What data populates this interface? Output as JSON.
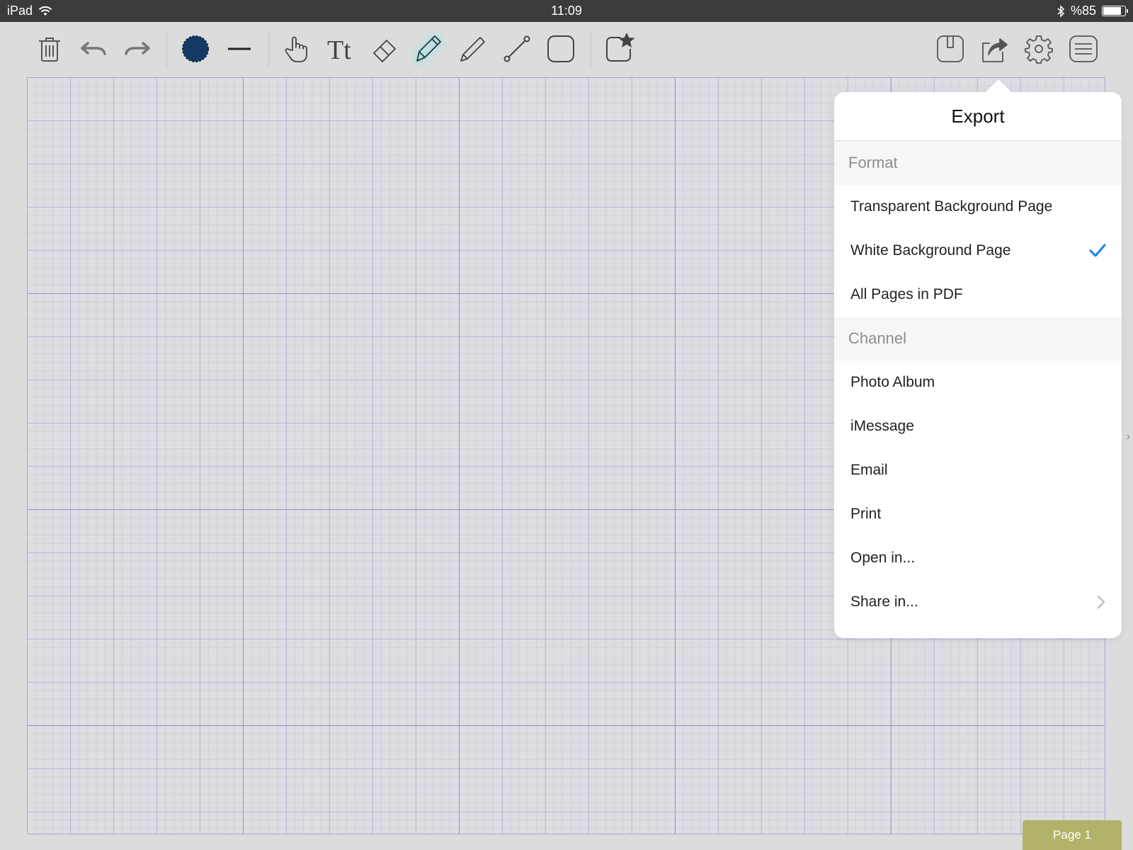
{
  "status_bar": {
    "device": "iPad",
    "time": "11:09",
    "battery": "%85",
    "battery_level": 0.85
  },
  "toolbar": {
    "tools": [
      "trash-icon",
      "undo-icon",
      "redo-icon",
      "color-swatch-icon",
      "line-width-icon",
      "hand-icon",
      "text-icon",
      "eraser-icon",
      "pen-icon",
      "pencil-icon",
      "line-tool-icon",
      "shape-icon",
      "favorites-icon",
      "page-icon",
      "share-icon",
      "gear-icon",
      "menu-icon"
    ],
    "active_tool": "pen-icon",
    "colors": {
      "icon": "#555555",
      "swatch": "#123a63",
      "glow": "#7fe0e6"
    }
  },
  "export_popover": {
    "title": "Export",
    "format_header": "Format",
    "format_options": [
      {
        "label": "Transparent Background Page",
        "selected": false
      },
      {
        "label": "White Background Page",
        "selected": true
      },
      {
        "label": "All Pages in PDF",
        "selected": false
      }
    ],
    "channel_header": "Channel",
    "channel_options": [
      {
        "label": "Photo Album",
        "has_submenu": false
      },
      {
        "label": "iMessage",
        "has_submenu": false
      },
      {
        "label": "Email",
        "has_submenu": false
      },
      {
        "label": "Print",
        "has_submenu": false
      },
      {
        "label": "Open in...",
        "has_submenu": false
      },
      {
        "label": "Share in...",
        "has_submenu": true
      }
    ],
    "check_color": "#1a7ff0"
  },
  "page_indicator": {
    "label": "Page 1"
  }
}
